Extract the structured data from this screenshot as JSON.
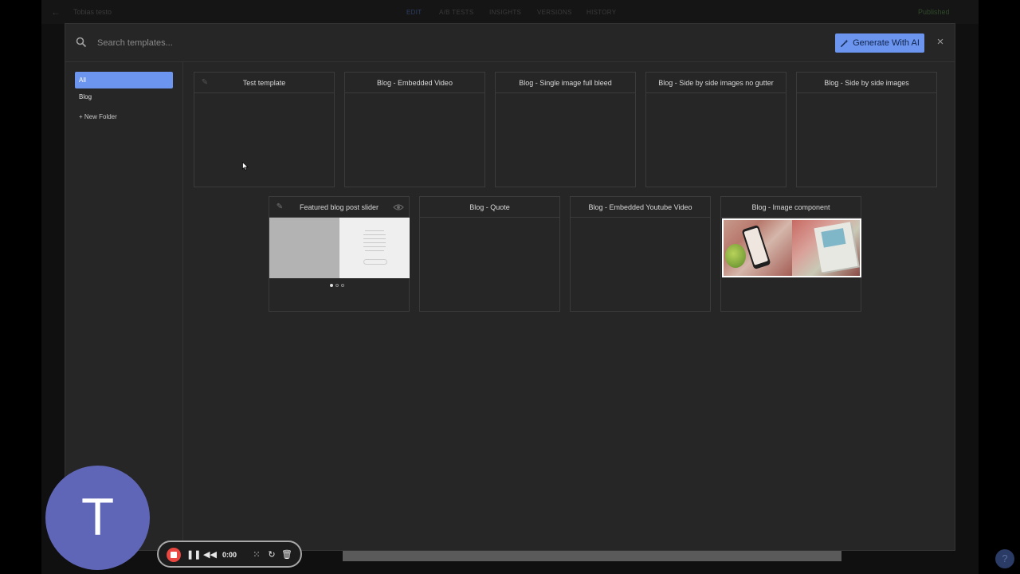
{
  "background_app": {
    "page_title": "Tobias testo",
    "tabs": [
      "EDIT",
      "A/B TESTS",
      "INSIGHTS",
      "VERSIONS",
      "HISTORY"
    ],
    "active_tab": "EDIT",
    "status": "Published"
  },
  "modal": {
    "search": {
      "placeholder": "Search templates..."
    },
    "generate_button": "Generate With AI",
    "close_label": "×",
    "sidebar": {
      "items": [
        {
          "label": "All",
          "active": true
        },
        {
          "label": "Blog",
          "active": false
        }
      ],
      "new_folder": "+ New Folder"
    },
    "templates": [
      {
        "title": "Test template"
      },
      {
        "title": "Blog - Embedded Video"
      },
      {
        "title": "Blog - Single image full bleed"
      },
      {
        "title": "Blog - Side by side images no gutter"
      },
      {
        "title": "Blog - Side by side images"
      },
      {
        "title": "Featured blog post slider"
      },
      {
        "title": "Blog - Quote"
      },
      {
        "title": "Blog - Embedded Youtube Video"
      },
      {
        "title": "Blog - Image component"
      }
    ]
  },
  "recorder": {
    "avatar_letter": "T",
    "avatar_color": "#5f66b8",
    "time": "0:00",
    "icons": [
      "stop-icon",
      "pause-icon",
      "rewind-icon",
      "grid-icon",
      "restart-icon",
      "trash-icon"
    ]
  },
  "colors": {
    "accent": "#6b95ee",
    "modal_bg": "#262626",
    "record_red": "#e9473f"
  }
}
